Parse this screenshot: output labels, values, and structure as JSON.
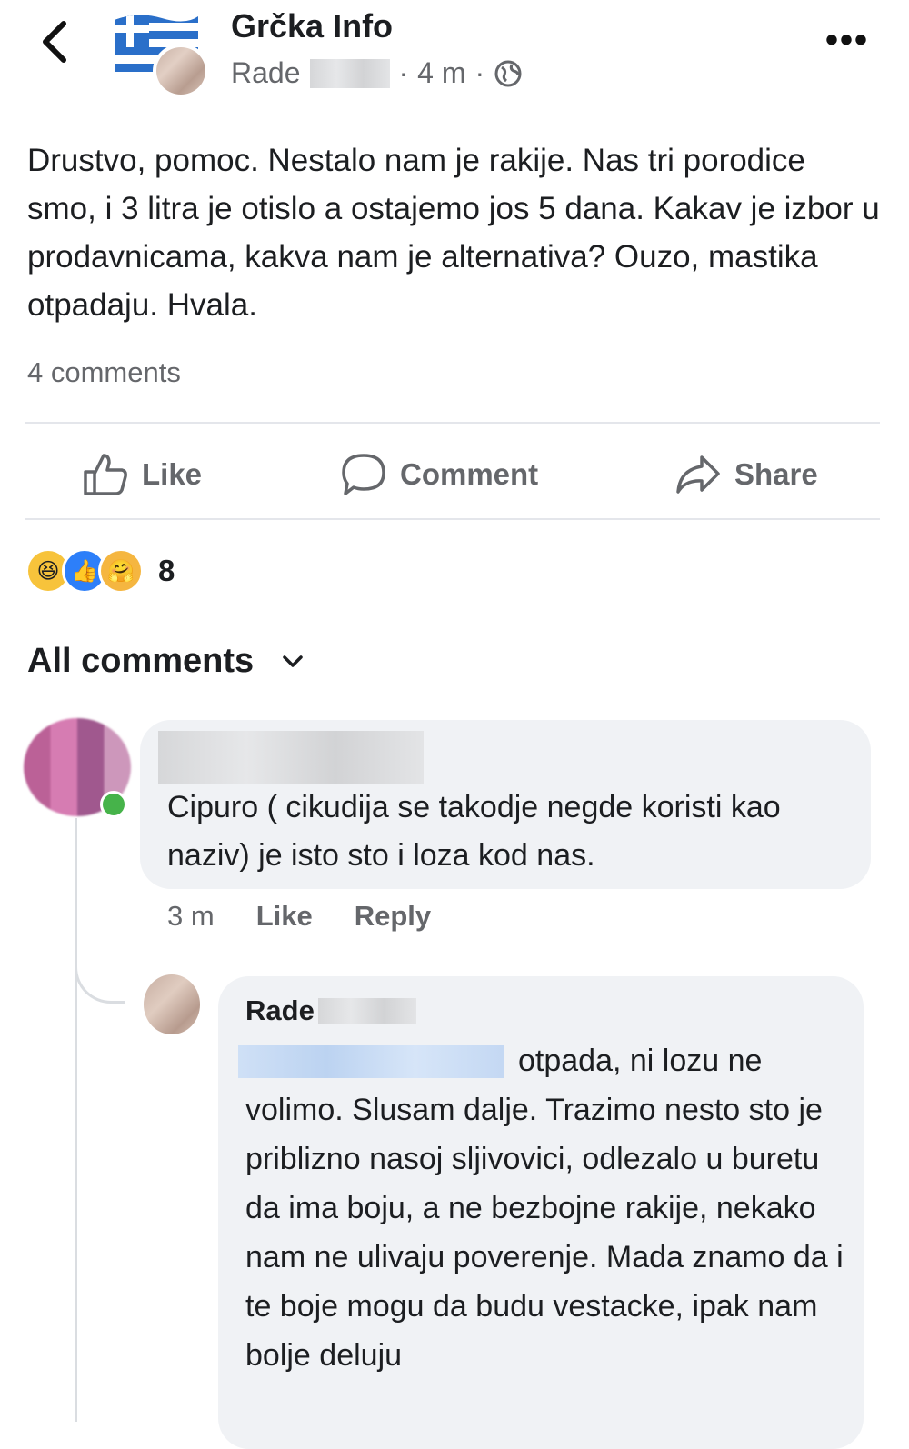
{
  "header": {
    "back_icon": "chevron-left-icon",
    "group_name": "Grčka Info",
    "author": "Rade",
    "separator": "·",
    "time": "4 m",
    "audience_icon": "globe-icon",
    "more_icon": "more-horizontal-icon",
    "more_label": "•••"
  },
  "post": {
    "text": "Drustvo, pomoc. Nestalo nam je rakije. Nas tri porodice smo, i 3 litra je otislo a ostajemo jos 5 dana. Kakav je izbor u prodavnicama, kakva nam je alternativa? Ouzo, mastika otpadaju. Hvala.",
    "comments_count": "4 comments"
  },
  "actions": {
    "like": "Like",
    "comment": "Comment",
    "share": "Share"
  },
  "reactions": {
    "icons": [
      "haha-reaction-icon",
      "like-reaction-icon",
      "care-reaction-icon"
    ],
    "count": "8"
  },
  "comments_section": {
    "filter_label": "All comments",
    "filter_icon": "chevron-down-icon"
  },
  "comments": [
    {
      "text": "Cipuro ( cikudija se takodje negde koristi kao naziv) je isto sto i loza kod nas.",
      "time": "3 m",
      "like": "Like",
      "reply": "Reply"
    },
    {
      "author": "Rade",
      "text": "otpada, ni lozu ne volimo. Slusam dalje. Trazimo nesto sto je priblizno nasoj sljivovici, odlezalo u buretu da ima boju, a ne bezbojne rakije, nekako nam ne ulivaju poverenje. Mada znamo da i te boje mogu da budu vestacke, ipak nam bolje deluju"
    }
  ],
  "colors": {
    "text_primary": "#1c1e21",
    "text_secondary": "#65676b",
    "bubble": "#f0f2f5",
    "like_blue": "#2d7ff9"
  }
}
